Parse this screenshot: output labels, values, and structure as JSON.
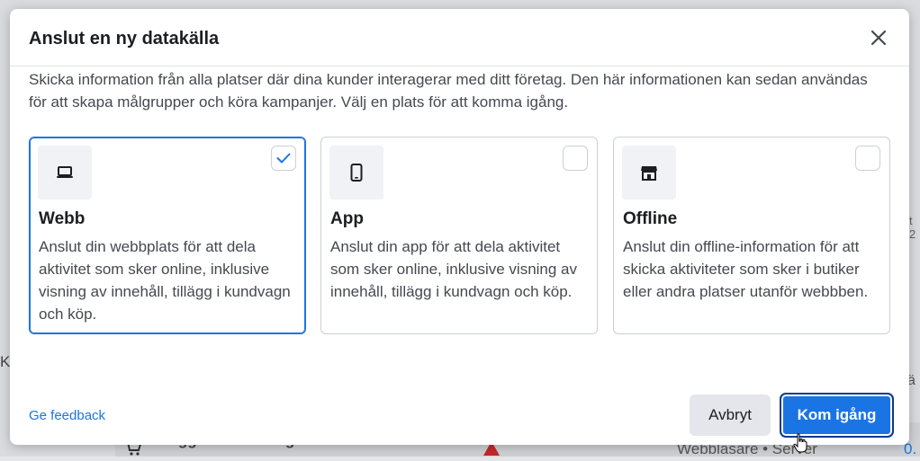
{
  "background": {
    "row_text": "Lägg till i kundvagn",
    "row_source": "Webbläsare • Server",
    "row_value": "0.",
    "left_letter": "K",
    "right_char_1": "t 2",
    "right_char_2": "ä"
  },
  "modal": {
    "title": "Anslut en ny datakälla",
    "description": "Skicka information från alla platser där dina kunder interagerar med ditt företag. Den här informationen kan sedan användas för att skapa målgrupper och köra kampanjer. Välj en plats för att komma igång.",
    "cards": [
      {
        "icon": "laptop-icon",
        "title": "Webb",
        "description": "Anslut din webbplats för att dela aktivitet som sker online, inklusive visning av innehåll, tillägg i kundvagn och köp.",
        "selected": true
      },
      {
        "icon": "mobile-phone-icon",
        "title": "App",
        "description": "Anslut din app för att dela aktivitet som sker online, inklusive visning av innehåll, tillägg i kundvagn och köp.",
        "selected": false
      },
      {
        "icon": "storefront-icon",
        "title": "Offline",
        "description": "Anslut din offline-information för att skicka aktiviteter som sker i butiker eller andra platser utanför webbben.",
        "selected": false
      }
    ],
    "feedback_link": "Ge feedback",
    "cancel_label": "Avbryt",
    "primary_label": "Kom igång"
  },
  "colors": {
    "accent": "#1b74e4",
    "text": "#1c1e21",
    "muted_text": "#444950",
    "border": "#ccd0d5"
  }
}
